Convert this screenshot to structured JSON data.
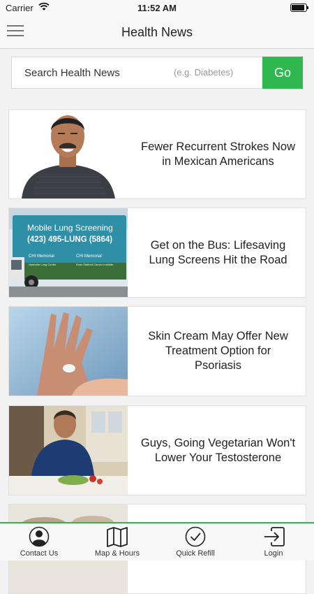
{
  "status_bar": {
    "carrier": "Carrier",
    "time": "11:52 AM",
    "battery_level": 0.9
  },
  "header": {
    "title": "Health News",
    "menu_icon": "hamburger-menu-icon"
  },
  "search": {
    "label": "Search Health News",
    "hint": "(e.g. Diabetes)",
    "go_label": "Go"
  },
  "articles": [
    {
      "headline": "Fewer Recurrent Strokes Now in Mexican Americans",
      "image": "portrait of smiling man in gray sweater"
    },
    {
      "headline": "Get on the Bus: Lifesaving Lung Screens Hit the Road",
      "image": "mobile lung screening bus"
    },
    {
      "headline": "Skin Cream May Offer New Treatment Option for Psoriasis",
      "image": "hand applying cream"
    },
    {
      "headline": "Guys, Going Vegetarian Won't Lower Your Testosterone",
      "image": "man preparing vegetables in kitchen"
    },
    {
      "headline": "",
      "image": "partially visible food photo"
    }
  ],
  "bus_signage": {
    "line1": "Mobile Lung Screening",
    "line2": "(423) 495-LUNG (5864)",
    "brand": "CHI Memorial",
    "sub1": "Nashville Lung Center",
    "sub2": "Ross Stafford Cancer Institute"
  },
  "tab_bar": {
    "accent": "#2eb84f",
    "tabs": [
      {
        "label": "Contact Us",
        "icon": "person-icon"
      },
      {
        "label": "Map & Hours",
        "icon": "map-icon"
      },
      {
        "label": "Quick Refill",
        "icon": "checkmark-circle-icon"
      },
      {
        "label": "Login",
        "icon": "login-arrow-icon"
      }
    ]
  }
}
